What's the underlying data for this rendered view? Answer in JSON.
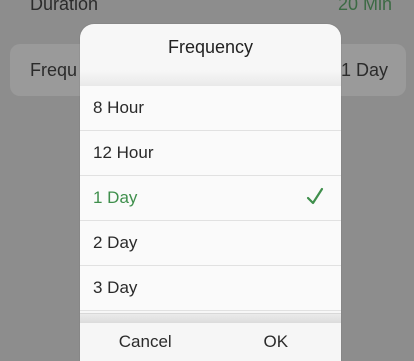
{
  "background": {
    "duration_label": "Duration",
    "duration_value": "20 Min",
    "frequency_label": "Frequ",
    "frequency_value": "1 Day"
  },
  "dialog": {
    "title": "Frequency",
    "options": [
      {
        "label": "8 Hour",
        "selected": false
      },
      {
        "label": "12 Hour",
        "selected": false
      },
      {
        "label": "1 Day",
        "selected": true
      },
      {
        "label": "2 Day",
        "selected": false
      },
      {
        "label": "3 Day",
        "selected": false
      }
    ],
    "cancel_label": "Cancel",
    "ok_label": "OK"
  },
  "icons": {
    "check": "check-icon"
  },
  "colors": {
    "accent": "#3f8f4c",
    "overlay": "#8d8d8d"
  }
}
